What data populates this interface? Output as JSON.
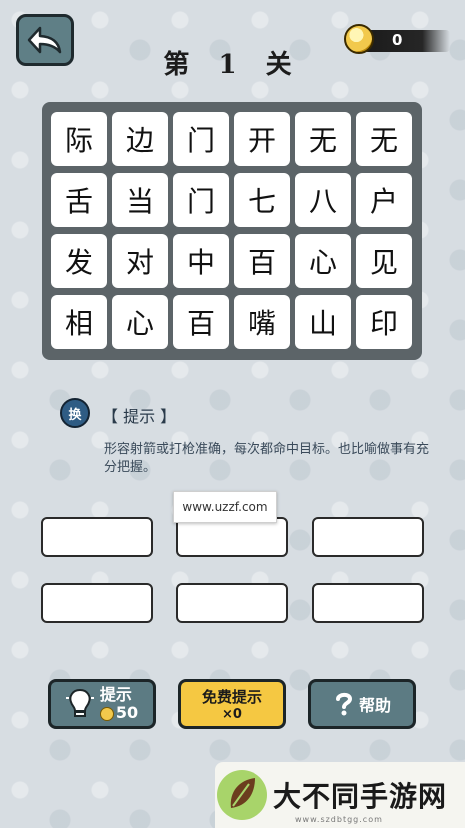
{
  "header": {
    "title": "第 1 关",
    "coins": "0"
  },
  "grid": {
    "rows": [
      [
        "际",
        "边",
        "门",
        "开",
        "无",
        "无"
      ],
      [
        "舌",
        "当",
        "门",
        "七",
        "八",
        "户"
      ],
      [
        "发",
        "对",
        "中",
        "百",
        "心",
        "见"
      ],
      [
        "相",
        "心",
        "百",
        "嘴",
        "山",
        "印"
      ]
    ]
  },
  "hint": {
    "swap_label": "换",
    "label": "【 提示 】",
    "text": "形容射箭或打枪准确，每次都命中目标。也比喻做事有充分把握。"
  },
  "watermark": "www.uzzf.com",
  "buttons": {
    "hint_label": "提示",
    "hint_cost": "50",
    "free_label": "免费提示",
    "free_count": "×0",
    "help_label": "帮助"
  },
  "banner": {
    "text": "大不同手游网",
    "url": "www.szdbtgg.com"
  }
}
